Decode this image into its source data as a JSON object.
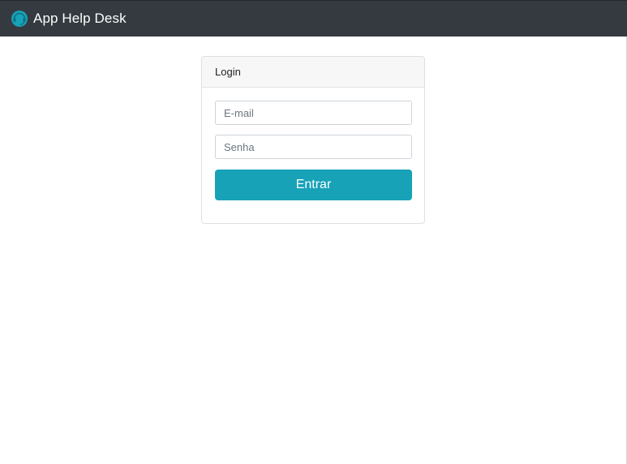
{
  "navbar": {
    "brand_text": "App Help Desk",
    "brand_icon": "headset-icon",
    "background": "#343a40"
  },
  "login_card": {
    "header": "Login",
    "email": {
      "value": "",
      "placeholder": "E-mail"
    },
    "password": {
      "value": "",
      "placeholder": "Senha"
    },
    "submit_label": "Entrar",
    "accent": "#17a2b8"
  }
}
